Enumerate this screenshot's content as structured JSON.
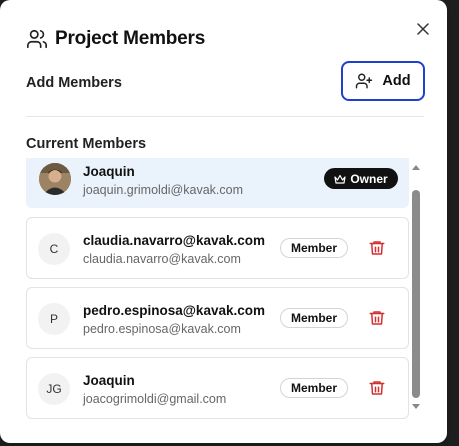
{
  "dialog": {
    "title": "Project Members",
    "title_icon": "users-icon",
    "close_icon": "close-icon"
  },
  "add_section": {
    "label": "Add Members",
    "button_label": "Add",
    "button_icon": "user-plus-icon"
  },
  "current_section": {
    "label": "Current Members"
  },
  "members": [
    {
      "avatar": "",
      "name": "Joaquin",
      "email": "joaquin.grimoldi@kavak.com",
      "role": "Owner",
      "photo": true
    },
    {
      "avatar": "C",
      "name": "claudia.navarro@kavak.com",
      "email": "claudia.navarro@kavak.com",
      "role": "Member"
    },
    {
      "avatar": "P",
      "name": "pedro.espinosa@kavak.com",
      "email": "pedro.espinosa@kavak.com",
      "role": "Member"
    },
    {
      "avatar": "JG",
      "name": "Joaquin",
      "email": "joacogrimoldi@gmail.com",
      "role": "Member"
    }
  ],
  "colors": {
    "accent": "#1f3fd1",
    "owner_row_bg": "#eaf2fc",
    "delete": "#d32f2f",
    "owner_badge_bg": "#111111"
  }
}
